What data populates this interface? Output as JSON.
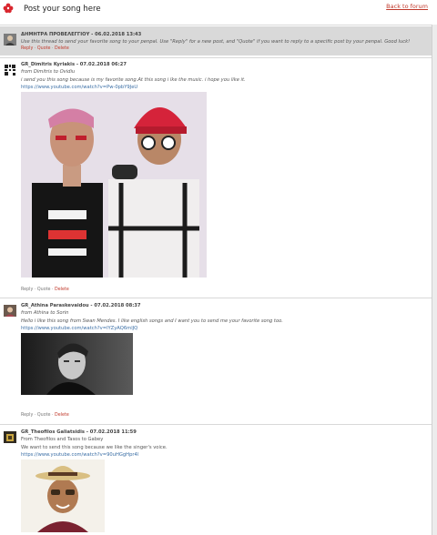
{
  "header": {
    "title": "Post your song here",
    "back_link": "Back to forum"
  },
  "pinned": {
    "author": "ΔΗΜΗΤΡΑ ΠΡΟΒΕΛΕΓΓΙΟΥ",
    "date": " - 06.02.2018 13:43",
    "text": "Use this thread to send your favorite song to your penpal. Use \"Reply\" for a new post, and \"Quote\" if you want to reply to a specific post by your penpal. Good luck!",
    "reply": "Reply",
    "quote": "Quote",
    "delete": "Delete"
  },
  "posts": [
    {
      "author": "GR_Dimitris Kyriakis",
      "date": " - 07.02.2018 06:27",
      "from": "from Dimitris to Ovidiu",
      "text": "i send you this song because is my favorite song.At this song i lke the music. i hope you like it.",
      "link": "https://www.youtube.com/watch?v=Pw-0pbY9JeU",
      "reply": "Reply",
      "quote": "Quote",
      "delete": "Delete"
    },
    {
      "author": "GR_Athina Paraskevaidou",
      "date": " - 07.02.2018 08:37",
      "from": "from Athina to Sorin",
      "text": "Hello i like this song from Swan Mendes. I like english songs and I want you to send me your favorite song too.",
      "link": "https://www.youtube.com/watch?v=lYZyAQ6mlJQ",
      "reply": "Reply",
      "quote": "Quote",
      "delete": "Delete"
    },
    {
      "author": "GR_Theofilos Galiatsidis",
      "date": " - 07.02.2018 11:59",
      "from": "From Theofilos and Tasos to Gabey",
      "text": "We want to send this song because we like the singer's voice.",
      "link": "https://www.youtube.com/watch?v=90uHGgHpr4l"
    }
  ],
  "colors": {
    "accent_red": "#c0392b",
    "link_blue": "#3a6ea5",
    "pinned_bg": "#d9d9d9"
  }
}
